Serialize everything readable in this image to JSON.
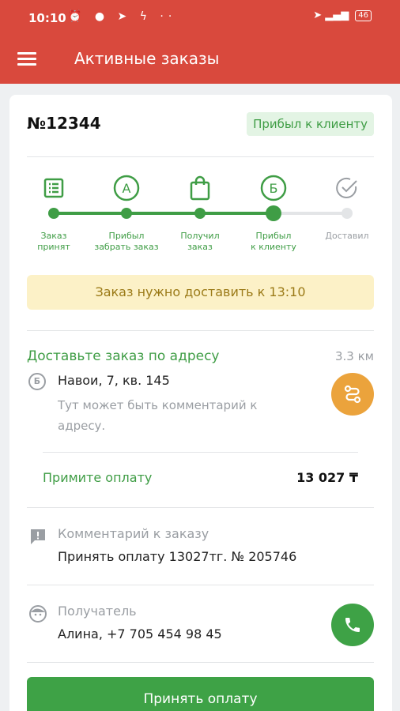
{
  "status_bar": {
    "time": "10:10",
    "left_icons": "⏰ ● ➤ ϟ ··",
    "right_icons": "➤ ▂▄▆",
    "battery": "46"
  },
  "header": {
    "title": "Активные заказы",
    "background_color": "#d9493d"
  },
  "order": {
    "number": "№12344",
    "status_badge": "Прибыл к клиенту"
  },
  "steps": [
    {
      "label": "Заказ\nпринят",
      "icon": "list-icon",
      "state": "done"
    },
    {
      "label": "Прибыл\nзабрать заказ",
      "icon": "circle-a-icon",
      "state": "done",
      "icon_text": "A"
    },
    {
      "label": "Получил\nзаказ",
      "icon": "shopping-bag-icon",
      "state": "done"
    },
    {
      "label": "Прибыл\nк клиенту",
      "icon": "circle-b-icon",
      "state": "current",
      "icon_text": "Б"
    },
    {
      "label": "Доставил",
      "icon": "check-circle-icon",
      "state": "pending"
    }
  ],
  "deadline": {
    "text": "Заказ нужно доставить к 13:10"
  },
  "delivery": {
    "title": "Доставьте заказ по адресу",
    "distance": "3.3 км",
    "point_letter": "Б",
    "address": "Навои, 7, кв. 145",
    "comment": "Тут может быть комментарий к адресу."
  },
  "payment": {
    "label": "Примите оплату",
    "amount": "13 027 ₸"
  },
  "order_comment": {
    "title": "Комментарий к заказу",
    "text": "Принять оплату 13027тг. № 205746"
  },
  "recipient": {
    "title": "Получатель",
    "text": "Алина, +7 705 454 98 45"
  },
  "actions": {
    "accept_payment": "Принять оплату"
  },
  "colors": {
    "accent_green": "#3ea246",
    "deadline_bg": "#fcf1c7",
    "route_orange": "#eba33c"
  }
}
